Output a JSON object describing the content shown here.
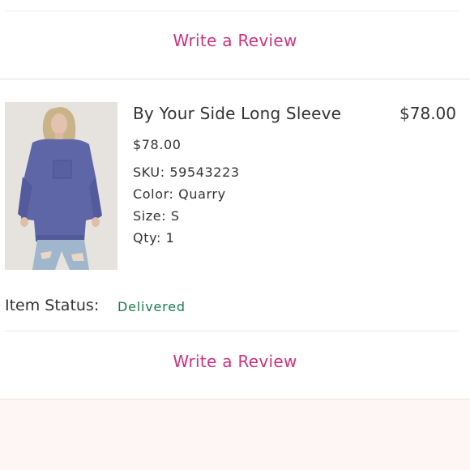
{
  "top_review": {
    "label": "Write a Review"
  },
  "item": {
    "title": "By Your Side Long Sleeve",
    "total": "$78.00",
    "price": "$78.00",
    "sku": "SKU: 59543223",
    "color": "Color: Quarry",
    "size": "Size: S",
    "qty": "Qty: 1",
    "image_icon": "product-photo",
    "colors": {
      "sweater": "#5e66a8",
      "denim": "#9fb6cc"
    }
  },
  "status": {
    "label": "Item Status:",
    "value": "Delivered",
    "value_color": "#1c7a52"
  },
  "bottom_review": {
    "label": "Write a Review"
  },
  "theme": {
    "accent": "#c8347f"
  }
}
